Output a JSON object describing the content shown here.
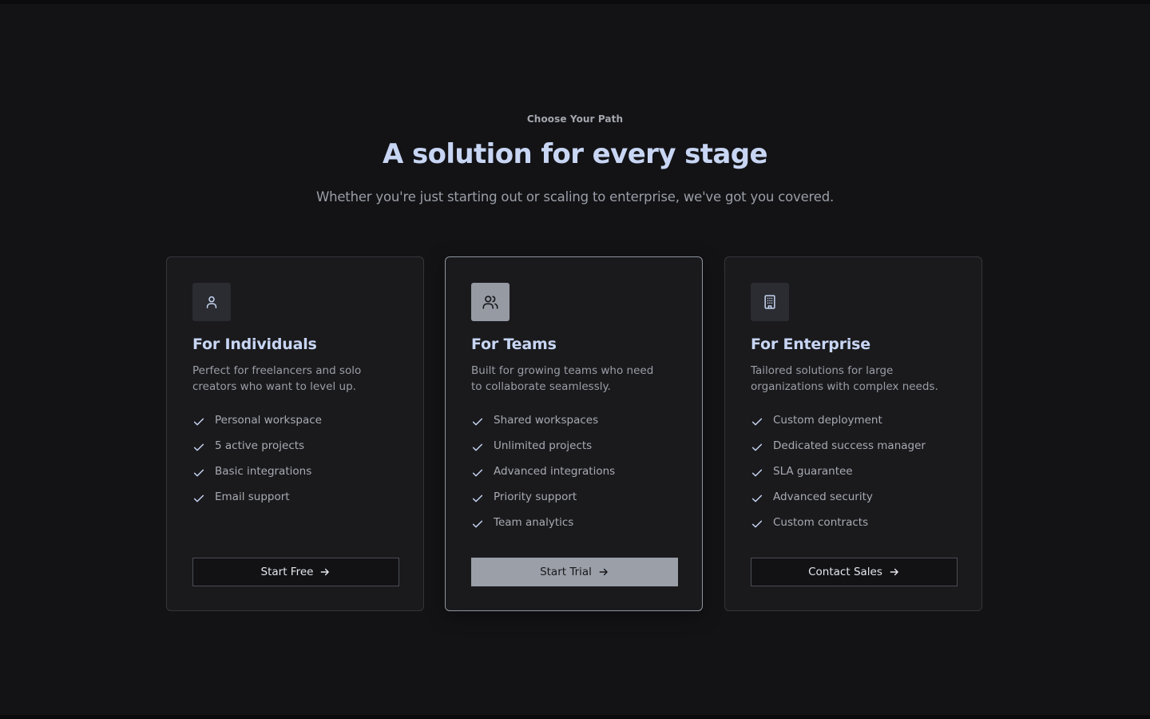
{
  "section": {
    "eyebrow": "Choose Your Path",
    "headline": "A solution for every stage",
    "subhead": "Whether you're just starting out or scaling to enterprise, we've got you covered."
  },
  "colors": {
    "background": "#131316",
    "card": "#1a1a1d",
    "heading": "#c8d6f4",
    "muted": "#9a9ea6",
    "featured_accent": "#9a9fa8"
  },
  "cards": [
    {
      "icon": "user-icon",
      "title": "For Individuals",
      "description": "Perfect for freelancers and solo creators who want to level up.",
      "features": [
        "Personal workspace",
        "5 active projects",
        "Basic integrations",
        "Email support"
      ],
      "cta": "Start Free",
      "featured": false
    },
    {
      "icon": "users-icon",
      "title": "For Teams",
      "description": "Built for growing teams who need to collaborate seamlessly.",
      "features": [
        "Shared workspaces",
        "Unlimited projects",
        "Advanced integrations",
        "Priority support",
        "Team analytics"
      ],
      "cta": "Start Trial",
      "featured": true
    },
    {
      "icon": "building-icon",
      "title": "For Enterprise",
      "description": "Tailored solutions for large organizations with complex needs.",
      "features": [
        "Custom deployment",
        "Dedicated success manager",
        "SLA guarantee",
        "Advanced security",
        "Custom contracts"
      ],
      "cta": "Contact Sales",
      "featured": false
    }
  ]
}
